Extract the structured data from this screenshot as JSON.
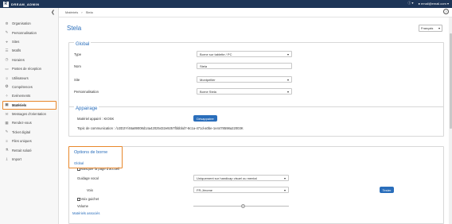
{
  "topbar": {
    "logo_letter": "R",
    "brand": "DREAM_ADMIN",
    "account": "email@email.com",
    "info_icon": "info-icon",
    "user_icon": "user-icon"
  },
  "breadcrumb": {
    "items": [
      "Matériels",
      "Stela"
    ],
    "help": "?"
  },
  "sidebar": {
    "collapse": "❮",
    "items": [
      {
        "label": "Organisation",
        "icon": "gear-icon"
      },
      {
        "label": "Personnalisation",
        "icon": "brush-icon"
      },
      {
        "label": "Sites",
        "icon": "pin-icon"
      },
      {
        "label": "Motifs",
        "icon": "list-icon"
      },
      {
        "label": "Horaires",
        "icon": "clock-icon"
      },
      {
        "label": "Postes de réception",
        "icon": "desk-icon"
      },
      {
        "label": "Utilisateurs",
        "icon": "user-icon"
      },
      {
        "label": "Compétences",
        "icon": "skill-icon"
      },
      {
        "label": "Evénements",
        "icon": "event-icon"
      },
      {
        "label": "Matériels",
        "icon": "device-icon"
      },
      {
        "label": "Messages d'orientation",
        "icon": "message-icon"
      },
      {
        "label": "Rendez-vous",
        "icon": "calendar-icon"
      },
      {
        "label": "Ticket digital",
        "icon": "ticket-icon"
      },
      {
        "label": "Files uniques",
        "icon": "queue-icon"
      },
      {
        "label": "Retrait soluté",
        "icon": "flask-icon"
      },
      {
        "label": "Import",
        "icon": "import-icon"
      }
    ],
    "active_index": 9
  },
  "page": {
    "title": "Stela",
    "language": "Français"
  },
  "global": {
    "title": "Global",
    "fields": [
      {
        "label": "Type",
        "value": "Borne sur tablette / PC",
        "kind": "select"
      },
      {
        "label": "Nom",
        "value": "Stela",
        "kind": "input"
      },
      {
        "label": "Site",
        "value": "Montpellier",
        "kind": "select"
      },
      {
        "label": "Personnalisation",
        "value": "Borne Stela",
        "kind": "select"
      }
    ]
  },
  "pairing": {
    "title": "Appairage",
    "device_text": "Matériel appairé : KIOSK",
    "unpair_button": "Désappairer",
    "comm_topic": "Topic de communication : /U2D2Y/46a89008d14a42025432e9257fbbbbd7-8c1a-471d-a0be-1e4478598a22003K"
  },
  "kiosk": {
    "title": "Options de borne",
    "subsection": "Global",
    "hide_home": "Masquer la page d'accueil",
    "visual_guidance_label": "Guidage vocal",
    "visual_guidance_value": "Uniquement sur handicap visuel ou mental",
    "voice_label": "Voix",
    "voice_value": "FR-Jérome",
    "test_button": "Tester",
    "show_window": "Voix guichet",
    "volume_label": "Volume",
    "volume_level": 0.52,
    "materials_link": "Matériels associés"
  }
}
